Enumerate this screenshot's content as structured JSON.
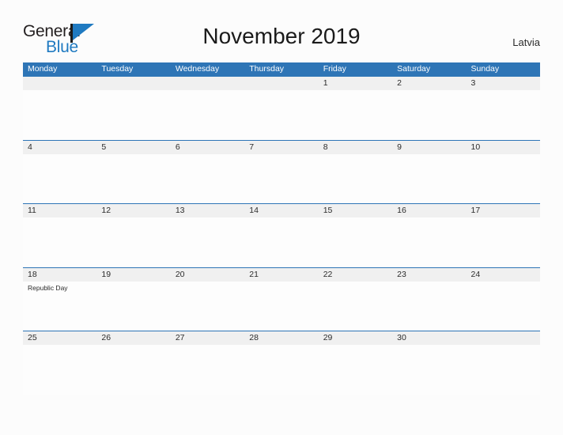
{
  "logo": {
    "word_one": "General",
    "word_two": "Blue",
    "flag_icon": "blue-flag-triangle-icon"
  },
  "header": {
    "title": "November 2019",
    "region": "Latvia"
  },
  "calendar": {
    "month": "November",
    "year": "2019",
    "weekday_headers": [
      "Monday",
      "Tuesday",
      "Wednesday",
      "Thursday",
      "Friday",
      "Saturday",
      "Sunday"
    ],
    "weeks": [
      [
        {
          "day": "",
          "event": ""
        },
        {
          "day": "",
          "event": ""
        },
        {
          "day": "",
          "event": ""
        },
        {
          "day": "",
          "event": ""
        },
        {
          "day": "1",
          "event": ""
        },
        {
          "day": "2",
          "event": ""
        },
        {
          "day": "3",
          "event": ""
        }
      ],
      [
        {
          "day": "4",
          "event": ""
        },
        {
          "day": "5",
          "event": ""
        },
        {
          "day": "6",
          "event": ""
        },
        {
          "day": "7",
          "event": ""
        },
        {
          "day": "8",
          "event": ""
        },
        {
          "day": "9",
          "event": ""
        },
        {
          "day": "10",
          "event": ""
        }
      ],
      [
        {
          "day": "11",
          "event": ""
        },
        {
          "day": "12",
          "event": ""
        },
        {
          "day": "13",
          "event": ""
        },
        {
          "day": "14",
          "event": ""
        },
        {
          "day": "15",
          "event": ""
        },
        {
          "day": "16",
          "event": ""
        },
        {
          "day": "17",
          "event": ""
        }
      ],
      [
        {
          "day": "18",
          "event": "Republic Day"
        },
        {
          "day": "19",
          "event": ""
        },
        {
          "day": "20",
          "event": ""
        },
        {
          "day": "21",
          "event": ""
        },
        {
          "day": "22",
          "event": ""
        },
        {
          "day": "23",
          "event": ""
        },
        {
          "day": "24",
          "event": ""
        }
      ],
      [
        {
          "day": "25",
          "event": ""
        },
        {
          "day": "26",
          "event": ""
        },
        {
          "day": "27",
          "event": ""
        },
        {
          "day": "28",
          "event": ""
        },
        {
          "day": "29",
          "event": ""
        },
        {
          "day": "30",
          "event": ""
        },
        {
          "day": "",
          "event": ""
        }
      ]
    ]
  },
  "colors": {
    "header_blue": "#2e75b6",
    "logo_blue": "#1f7ac1",
    "band_gray": "#f0f0f0",
    "page_background": "#fcfcfc",
    "text_dark": "#2b2b2b"
  }
}
